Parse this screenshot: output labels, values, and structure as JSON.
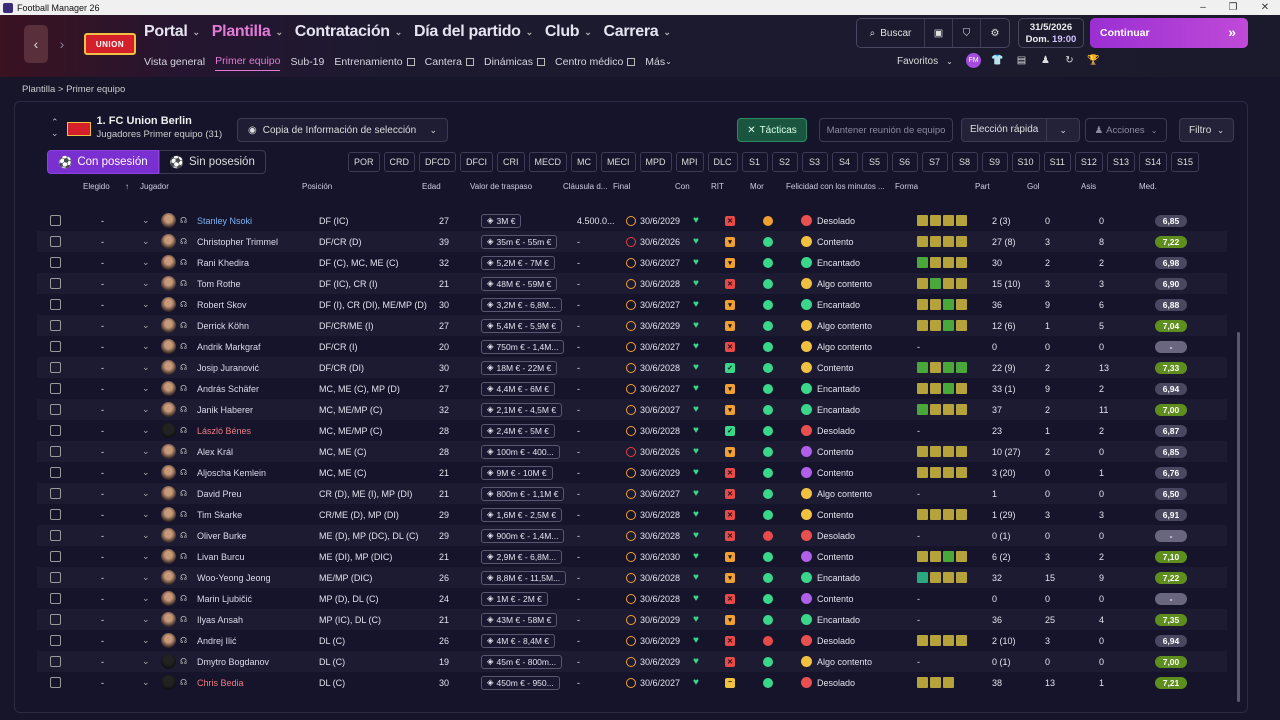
{
  "window": {
    "title": "Football Manager 26"
  },
  "nav": {
    "main": [
      {
        "label": "Portal",
        "active": false
      },
      {
        "label": "Plantilla",
        "active": true
      },
      {
        "label": "Contratación",
        "active": false
      },
      {
        "label": "Día del partido",
        "active": false
      },
      {
        "label": "Club",
        "active": false
      },
      {
        "label": "Carrera",
        "active": false
      }
    ],
    "sub": [
      {
        "label": "Vista general",
        "active": false,
        "ext": false
      },
      {
        "label": "Primer equipo",
        "active": true,
        "ext": false
      },
      {
        "label": "Sub-19",
        "active": false,
        "ext": false
      },
      {
        "label": "Entrenamiento",
        "active": false,
        "ext": true
      },
      {
        "label": "Cantera",
        "active": false,
        "ext": true
      },
      {
        "label": "Dinámicas",
        "active": false,
        "ext": true
      },
      {
        "label": "Centro médico",
        "active": false,
        "ext": true
      },
      {
        "label": "Más",
        "active": false,
        "ext": false
      }
    ],
    "club_logo_text": "UNION"
  },
  "top": {
    "search_label": "Buscar",
    "date": "31/5/2026",
    "day": "Dom.",
    "time": "19:00",
    "continue_label": "Continuar",
    "favorites_label": "Favoritos",
    "fav_badge": "FM"
  },
  "breadcrumb": {
    "root": "Plantilla",
    "sep": ">",
    "current": "Primer equipo"
  },
  "team": {
    "name": "1. FC Union Berlin",
    "subtitle": "Jugadores Primer equipo (31)"
  },
  "toolbar": {
    "copy": "Copia de Información de selección",
    "tactics": "Tácticas",
    "meeting": "Mantener reunión de equipo",
    "quick": "Elección rápida",
    "actions": "Acciones",
    "filter": "Filtro"
  },
  "possession": {
    "with": "Con posesión",
    "without": "Sin posesión"
  },
  "positions": [
    "POR",
    "CRD",
    "DFCD",
    "DFCI",
    "CRI",
    "MECD",
    "MC",
    "MECI",
    "MPD",
    "MPI",
    "DLC",
    "S1",
    "S2",
    "S3",
    "S4",
    "S5",
    "S6",
    "S7",
    "S8",
    "S9",
    "S10",
    "S11",
    "S12",
    "S13",
    "S14",
    "S15"
  ],
  "columns": {
    "elegido": "Elegido",
    "jugador": "Jugador",
    "posicion": "Posición",
    "edad": "Edad",
    "valor": "Valor de traspaso",
    "clausula": "Cláusula d...",
    "final": "Final",
    "con": "Con",
    "rit": "RIT",
    "mor": "Mor",
    "felicidad": "Felicidad con los minutos ...",
    "forma": "Forma",
    "part": "Part",
    "gol": "Gol",
    "asis": "Asis",
    "med": "Med."
  },
  "colors": {
    "accent": "#7a2fd0",
    "happy_green": "#3ad68a",
    "rating_green": "#5a8a20"
  },
  "players": [
    {
      "sel": "-",
      "name": "Stanley Nsoki",
      "nc": "blue",
      "pos": "DF (IC)",
      "age": "27",
      "val": "3M €",
      "cl": "4.500.0...",
      "fin": "30/6/2029",
      "ck": "o",
      "rit": "x",
      "mor": "o",
      "fel": "Desolado",
      "fc": "r",
      "forma": "yyyy",
      "part": "2 (3)",
      "gol": "0",
      "asis": "0",
      "med": "6,85",
      "mc": "d"
    },
    {
      "sel": "-",
      "name": "Christopher Trimmel",
      "nc": "",
      "pos": "DF/CR (D)",
      "age": "39",
      "val": "35m € - 55m €",
      "cl": "-",
      "fin": "30/6/2026",
      "ck": "r",
      "rit": "o",
      "mor": "g",
      "fel": "Contento",
      "fc": "y",
      "forma": "yyyy",
      "part": "27 (8)",
      "gol": "3",
      "asis": "8",
      "med": "7,22",
      "mc": "g"
    },
    {
      "sel": "-",
      "name": "Rani Khedira",
      "nc": "",
      "pos": "DF (C), MC, ME (C)",
      "age": "32",
      "val": "5,2M € - 7M €",
      "cl": "-",
      "fin": "30/6/2027",
      "ck": "o",
      "rit": "o",
      "mor": "g",
      "fel": "Encantado",
      "fc": "g",
      "forma": "gyyy",
      "part": "30",
      "gol": "2",
      "asis": "2",
      "med": "6,98",
      "mc": "d"
    },
    {
      "sel": "-",
      "name": "Tom Rothe",
      "nc": "",
      "pos": "DF (IC), CR (I)",
      "age": "21",
      "val": "48M € - 59M €",
      "cl": "-",
      "fin": "30/6/2028",
      "ck": "o",
      "rit": "x",
      "mor": "g",
      "fel": "Algo contento",
      "fc": "y",
      "forma": "ygyy",
      "part": "15 (10)",
      "gol": "3",
      "asis": "3",
      "med": "6,90",
      "mc": "d"
    },
    {
      "sel": "-",
      "name": "Robert Skov",
      "nc": "",
      "pos": "DF (I), CR (DI), ME/MP (D)",
      "age": "30",
      "val": "3,2M € - 6,8M...",
      "cl": "-",
      "fin": "30/6/2027",
      "ck": "o",
      "rit": "o",
      "mor": "g",
      "fel": "Encantado",
      "fc": "g",
      "forma": "yygy",
      "part": "36",
      "gol": "9",
      "asis": "6",
      "med": "6,88",
      "mc": "d"
    },
    {
      "sel": "-",
      "name": "Derrick Köhn",
      "nc": "",
      "pos": "DF/CR/ME (I)",
      "age": "27",
      "val": "5,4M € - 5,9M €",
      "cl": "-",
      "fin": "30/6/2029",
      "ck": "o",
      "rit": "o",
      "mor": "g",
      "fel": "Algo contento",
      "fc": "y",
      "forma": "yygy",
      "part": "12 (6)",
      "gol": "1",
      "asis": "5",
      "med": "7,04",
      "mc": "g"
    },
    {
      "sel": "-",
      "name": "Andrik Markgraf",
      "nc": "",
      "pos": "DF/CR (I)",
      "age": "20",
      "val": "750m € - 1,4M...",
      "cl": "-",
      "fin": "30/6/2027",
      "ck": "o",
      "rit": "x",
      "mor": "g",
      "fel": "Algo contento",
      "fc": "y",
      "forma": "",
      "part": "0",
      "gol": "0",
      "asis": "0",
      "med": "-",
      "mc": "d"
    },
    {
      "sel": "-",
      "name": "Josip Juranović",
      "nc": "",
      "pos": "DF/CR (DI)",
      "age": "30",
      "val": "18M € - 22M €",
      "cl": "-",
      "fin": "30/6/2028",
      "ck": "o",
      "rit": "v",
      "mor": "g",
      "fel": "Contento",
      "fc": "y",
      "forma": "gygg",
      "part": "22 (9)",
      "gol": "2",
      "asis": "13",
      "med": "7,33",
      "mc": "g"
    },
    {
      "sel": "-",
      "name": "András Schäfer",
      "nc": "",
      "pos": "MC, ME (C), MP (D)",
      "age": "27",
      "val": "4,4M € - 6M €",
      "cl": "-",
      "fin": "30/6/2027",
      "ck": "o",
      "rit": "o",
      "mor": "g",
      "fel": "Encantado",
      "fc": "g",
      "forma": "yygy",
      "part": "33 (1)",
      "gol": "9",
      "asis": "2",
      "med": "6,94",
      "mc": "d"
    },
    {
      "sel": "-",
      "name": "Janik Haberer",
      "nc": "",
      "pos": "MC, ME/MP (C)",
      "age": "32",
      "val": "2,1M € - 4,5M €",
      "cl": "-",
      "fin": "30/6/2027",
      "ck": "o",
      "rit": "o",
      "mor": "g",
      "fel": "Encantado",
      "fc": "g",
      "forma": "gyyy",
      "part": "37",
      "gol": "2",
      "asis": "11",
      "med": "7,00",
      "mc": "g"
    },
    {
      "sel": "-",
      "name": "László Bénes",
      "nc": "red",
      "pos": "MC, ME/MP (C)",
      "age": "28",
      "val": "2,4M € - 5M €",
      "cl": "-",
      "fin": "30/6/2028",
      "ck": "o",
      "rit": "v",
      "mor": "g",
      "fel": "Desolado",
      "fc": "r",
      "forma": "",
      "part": "23",
      "gol": "1",
      "asis": "2",
      "med": "6,87",
      "mc": "d"
    },
    {
      "sel": "-",
      "name": "Alex Král",
      "nc": "",
      "pos": "MC, ME (C)",
      "age": "28",
      "val": "100m € - 400...",
      "cl": "-",
      "fin": "30/6/2026",
      "ck": "r",
      "rit": "o",
      "mor": "g",
      "fel": "Contento",
      "fc": "p",
      "forma": "yyyy",
      "part": "10 (27)",
      "gol": "2",
      "asis": "0",
      "med": "6,85",
      "mc": "d"
    },
    {
      "sel": "-",
      "name": "Aljoscha Kemlein",
      "nc": "",
      "pos": "MC, ME (C)",
      "age": "21",
      "val": "9M € - 10M €",
      "cl": "-",
      "fin": "30/6/2029",
      "ck": "o",
      "rit": "x",
      "mor": "g",
      "fel": "Contento",
      "fc": "p",
      "forma": "yyyy",
      "part": "3 (20)",
      "gol": "0",
      "asis": "1",
      "med": "6,76",
      "mc": "d"
    },
    {
      "sel": "-",
      "name": "David Preu",
      "nc": "",
      "pos": "CR (D), ME (I), MP (DI)",
      "age": "21",
      "val": "800m € - 1,1M €",
      "cl": "-",
      "fin": "30/6/2027",
      "ck": "o",
      "rit": "x",
      "mor": "g",
      "fel": "Algo contento",
      "fc": "y",
      "forma": "",
      "part": "1",
      "gol": "0",
      "asis": "0",
      "med": "6,50",
      "mc": "d"
    },
    {
      "sel": "-",
      "name": "Tim Skarke",
      "nc": "",
      "pos": "CR/ME (D), MP (DI)",
      "age": "29",
      "val": "1,6M € - 2,5M €",
      "cl": "-",
      "fin": "30/6/2028",
      "ck": "o",
      "rit": "x",
      "mor": "g",
      "fel": "Contento",
      "fc": "y",
      "forma": "yyyy",
      "part": "1 (29)",
      "gol": "3",
      "asis": "3",
      "med": "6,91",
      "mc": "d"
    },
    {
      "sel": "-",
      "name": "Oliver Burke",
      "nc": "",
      "pos": "ME (D), MP (DC), DL (C)",
      "age": "29",
      "val": "900m € - 1,4M...",
      "cl": "-",
      "fin": "30/6/2028",
      "ck": "o",
      "rit": "x",
      "mor": "r",
      "fel": "Desolado",
      "fc": "r",
      "forma": "",
      "part": "0 (1)",
      "gol": "0",
      "asis": "0",
      "med": "-",
      "mc": "d"
    },
    {
      "sel": "-",
      "name": "Livan Burcu",
      "nc": "",
      "pos": "ME (DI), MP (DIC)",
      "age": "21",
      "val": "2,9M € - 6,8M...",
      "cl": "-",
      "fin": "30/6/2030",
      "ck": "o",
      "rit": "o",
      "mor": "g",
      "fel": "Contento",
      "fc": "p",
      "forma": "yygy",
      "part": "6 (2)",
      "gol": "3",
      "asis": "2",
      "med": "7,10",
      "mc": "g"
    },
    {
      "sel": "-",
      "name": "Woo-Yeong Jeong",
      "nc": "",
      "pos": "ME/MP (DIC)",
      "age": "26",
      "val": "8,8M € - 11,5M...",
      "cl": "-",
      "fin": "30/6/2028",
      "ck": "o",
      "rit": "o",
      "mor": "g",
      "fel": "Encantado",
      "fc": "g",
      "forma": "tyyy",
      "part": "32",
      "gol": "15",
      "asis": "9",
      "med": "7,22",
      "mc": "g"
    },
    {
      "sel": "-",
      "name": "Marin Ljubičić",
      "nc": "",
      "pos": "MP (D), DL (C)",
      "age": "24",
      "val": "1M € - 2M €",
      "cl": "-",
      "fin": "30/6/2028",
      "ck": "o",
      "rit": "x",
      "mor": "g",
      "fel": "Contento",
      "fc": "p",
      "forma": "",
      "part": "0",
      "gol": "0",
      "asis": "0",
      "med": "-",
      "mc": "d"
    },
    {
      "sel": "-",
      "name": "Ilyas Ansah",
      "nc": "",
      "pos": "MP (IC), DL (C)",
      "age": "21",
      "val": "43M € - 58M €",
      "cl": "-",
      "fin": "30/6/2029",
      "ck": "o",
      "rit": "o",
      "mor": "g",
      "fel": "Encantado",
      "fc": "g",
      "forma": "",
      "part": "36",
      "gol": "25",
      "asis": "4",
      "med": "7,35",
      "mc": "g"
    },
    {
      "sel": "-",
      "name": "Andrej Ilić",
      "nc": "",
      "pos": "DL (C)",
      "age": "26",
      "val": "4M € - 8,4M €",
      "cl": "-",
      "fin": "30/6/2029",
      "ck": "o",
      "rit": "x",
      "mor": "r",
      "fel": "Desolado",
      "fc": "r",
      "forma": "yyyy",
      "part": "2 (10)",
      "gol": "3",
      "asis": "0",
      "med": "6,94",
      "mc": "d"
    },
    {
      "sel": "-",
      "name": "Dmytro Bogdanov",
      "nc": "",
      "pos": "DL (C)",
      "age": "19",
      "val": "45m € - 800m...",
      "cl": "-",
      "fin": "30/6/2029",
      "ck": "o",
      "rit": "x",
      "mor": "g",
      "fel": "Algo contento",
      "fc": "y",
      "forma": "",
      "part": "0 (1)",
      "gol": "0",
      "asis": "0",
      "med": "7,00",
      "mc": "g"
    },
    {
      "sel": "-",
      "name": "Chris Bedia",
      "nc": "red",
      "pos": "DL (C)",
      "age": "30",
      "val": "450m € - 950...",
      "cl": "-",
      "fin": "30/6/2027",
      "ck": "o",
      "rit": "m",
      "mor": "g",
      "fel": "Desolado",
      "fc": "r",
      "forma": "yyy",
      "part": "38",
      "gol": "13",
      "asis": "1",
      "med": "7,21",
      "mc": "g"
    }
  ]
}
